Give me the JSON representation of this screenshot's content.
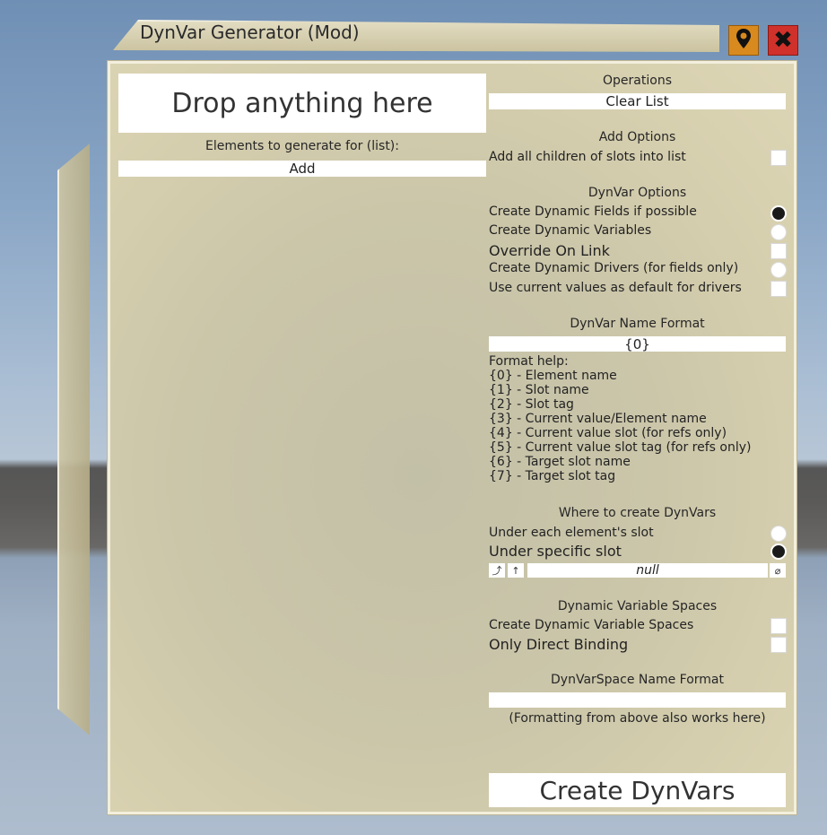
{
  "window": {
    "title": "DynVar Generator (Mod)",
    "pin_icon": "location-pin-icon",
    "close_icon": "close-icon",
    "close_glyph": "✖"
  },
  "left": {
    "drop_zone": "Drop anything here",
    "elements_label": "Elements to generate for (list):",
    "add_button": "Add"
  },
  "operations": {
    "heading": "Operations",
    "clear_list": "Clear List"
  },
  "add_options": {
    "heading": "Add Options",
    "add_children": "Add all children of slots into list"
  },
  "dynvar_options": {
    "heading": "DynVar Options",
    "create_fields": "Create Dynamic Fields if possible",
    "create_variables": "Create Dynamic Variables",
    "override_on_link": "Override On Link",
    "create_drivers": "Create Dynamic Drivers (for fields only)",
    "use_current": "Use current values as default for drivers"
  },
  "name_format": {
    "heading": "DynVar Name Format",
    "value": "{0}",
    "help_title": "Format help:",
    "help_lines": [
      "{0} - Element name",
      "{1} - Slot name",
      "{2} - Slot tag",
      "{3} - Current value/Element name",
      "{4} - Current value slot (for refs only)",
      "{5} - Current value slot tag (for refs only)",
      "{6} - Target slot name",
      "{7} - Target slot tag"
    ]
  },
  "where": {
    "heading": "Where to create DynVars",
    "under_each": "Under each element's slot",
    "under_specific": "Under specific slot",
    "ref_value": "null",
    "btn_jump": "⤴",
    "btn_up": "↑",
    "btn_clear": "⌀"
  },
  "spaces": {
    "heading": "Dynamic Variable Spaces",
    "create_spaces": "Create Dynamic Variable Spaces",
    "direct_binding": "Only Direct Binding"
  },
  "space_format": {
    "heading": "DynVarSpace Name Format",
    "value": "",
    "note": "(Formatting from above also works here)"
  },
  "create_button": "Create DynVars",
  "colors": {
    "panel": "#cbc6a9",
    "pin_button": "#d88a1e",
    "close_button": "#d0312a"
  }
}
